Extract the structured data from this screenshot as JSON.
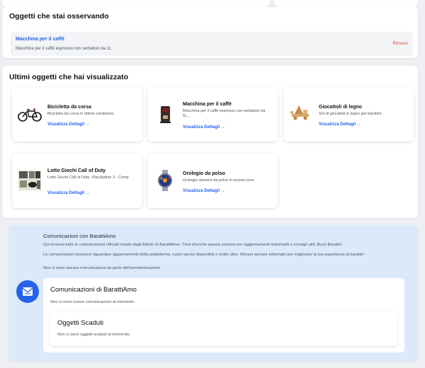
{
  "watching": {
    "heading": "Oggetti che stai osservando",
    "item": {
      "title": "Macchina per il caffè",
      "description": "Macchina per il caffè espresso con serbatoio da 1L.",
      "remove_label": "Rimuovi"
    }
  },
  "recent": {
    "heading": "Ultimi oggetti che hai visualizzato",
    "items": [
      {
        "title": "Bicicletta da corsa",
        "description": "Bicicletta da corsa in ottime condizioni.",
        "link": "Visualizza Dettagli →",
        "icon": "bicycle-icon"
      },
      {
        "title": "Macchina per il caffè",
        "description": "Macchina per il caffè espresso con serbatoio da 1L...",
        "link": "Visualizza Dettagli →",
        "icon": "coffee-machine-icon"
      },
      {
        "title": "Giocattoli di legno",
        "description": "Set di giocattoli in legno per bambini.",
        "link": "Visualizza Dettagli →",
        "icon": "wooden-toys-icon"
      },
      {
        "title": "Lotto Giochi Call of Duty",
        "description": "Lotto Giochi Call of Duty- PlayStation 3 - Comp",
        "link": "Visualizza Dettagli →",
        "icon": "game-bundle-icon"
      },
      {
        "title": "Orologio da polso",
        "description": "Orologio classico da polso in acciaio inox.",
        "link": "Visualizza Dettagli →",
        "icon": "wristwatch-icon"
      }
    ]
  },
  "communications": {
    "title": "Comunicazioni con BarattiAmo",
    "paragraph1": "Qui troverai tutte le comunicazioni ufficiali inviate dagli Admin di BarattiAmo. Tieni d'occhio questa sezione per aggiornamenti importanti e consigli utili. Buon Baratto!",
    "paragraph2": "Le comunicazioni possono riguardare aggiornamenti della piattaforma, nuovi servizi disponibili e molto altro. Rimani sempre informato per migliorare la tua esperienza di baratto!",
    "paragraph3": "Non ci sono ancora comunicazioni da parte dell'amministrazione.",
    "icon": "mail-icon",
    "box_title": "Comunicazioni di BarattiAmo",
    "box_text": "Non ci sono nuove comunicazioni al momento.",
    "expired_title": "Oggetti Scaduti",
    "expired_text": "Non ci sono oggetti scaduti al momento."
  },
  "colors": {
    "accent": "#2563eb",
    "danger": "#dc4a3a",
    "comm_bg": "#dbe9fb"
  }
}
